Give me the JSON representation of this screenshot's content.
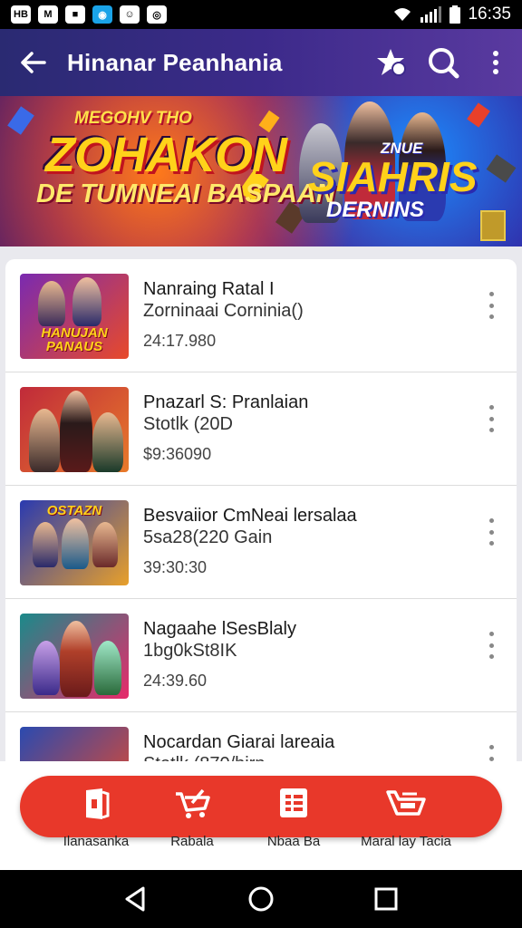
{
  "status_bar": {
    "time": "16:35",
    "notifications": [
      "HB",
      "M",
      "■",
      "◉",
      "☺",
      "◎"
    ],
    "icons": [
      "wifi-icon",
      "signal-icon",
      "battery-icon"
    ]
  },
  "app_bar": {
    "title": "Hinanar Peanhania",
    "icons": [
      "back-arrow-icon",
      "star-badge-icon",
      "search-icon",
      "more-vert-icon"
    ]
  },
  "banner": {
    "top_small": "MEGOHV THO",
    "title_left": "ZOHAKON",
    "subtitle_left": "DE TUMNEAI BASPAAN",
    "title_right_small": "ZNUE",
    "title_right": "SIAHRIS",
    "subtitle_right": "DERNINS"
  },
  "list": {
    "items": [
      {
        "title": "Nanraing Ratal I",
        "subtitle": "Zorninaai Corninia()",
        "meta": "24:17.980",
        "thumb_label": "HANUJAN PANAUS",
        "thumb_colors": [
          "#7a2ab0",
          "#e84a2a"
        ]
      },
      {
        "title": "Pnazarl S: Pranlaian",
        "subtitle": "Stotlk (20D",
        "meta": "$9:36090",
        "thumb_label": "",
        "thumb_colors": [
          "#c02a3a",
          "#e87a2a"
        ]
      },
      {
        "title": "Besvaiior CmNeai lersalaa",
        "subtitle": "5sa28(220 Gain",
        "meta": "39:30:30",
        "thumb_label": "OSTAZN",
        "thumb_colors": [
          "#2a3ab0",
          "#e8a02a"
        ]
      },
      {
        "title": "Nagaahe lSesBlaly",
        "subtitle": "1bg0kSt8IK",
        "meta": "24:39.60",
        "thumb_label": "",
        "thumb_colors": [
          "#1a8a8a",
          "#e82a6a"
        ]
      },
      {
        "title": "Nocardan Giarai lareaia",
        "subtitle": "Stotlk (870/hirn",
        "meta": "",
        "thumb_label": "",
        "thumb_colors": [
          "#2a4ab0",
          "#e84a2a"
        ]
      }
    ]
  },
  "bottom_nav": {
    "items": [
      {
        "label": "Ilanasanka",
        "icon": "bookmark-door-icon"
      },
      {
        "label": "Rabala",
        "icon": "cart-icon"
      },
      {
        "label": "Nbaa Ba",
        "icon": "list-icon"
      },
      {
        "label": "Maral lay Tacia",
        "icon": "tray-icon"
      }
    ]
  },
  "colors": {
    "app_bar": "#2f2a80",
    "accent": "#e8382a",
    "bottom_pill": "#e8382a"
  }
}
